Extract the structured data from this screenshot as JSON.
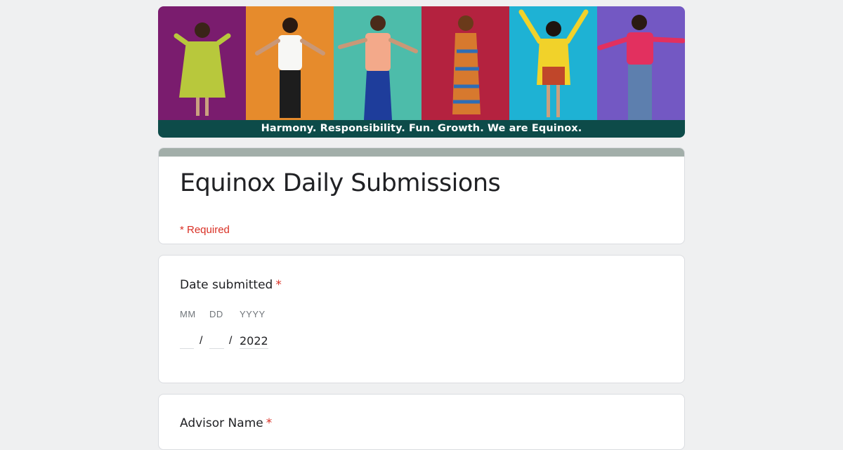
{
  "banner": {
    "caption": "Harmony. Responsibility. Fun. Growth. We are Equinox.",
    "strip_colors": [
      "#7a1c6e",
      "#e68b2c",
      "#4dbcaa",
      "#b4223f",
      "#1eb2d4",
      "#7358c3"
    ]
  },
  "form": {
    "title": "Equinox Daily Submissions",
    "required_note": "* Required"
  },
  "questions": [
    {
      "label": "Date submitted",
      "required_star": "*",
      "date": {
        "mm_label": "MM",
        "dd_label": "DD",
        "yyyy_label": "YYYY",
        "mm_value": "",
        "dd_value": "",
        "yyyy_value": "2022",
        "separator": "/"
      }
    },
    {
      "label": "Advisor Name",
      "required_star": "*"
    }
  ]
}
